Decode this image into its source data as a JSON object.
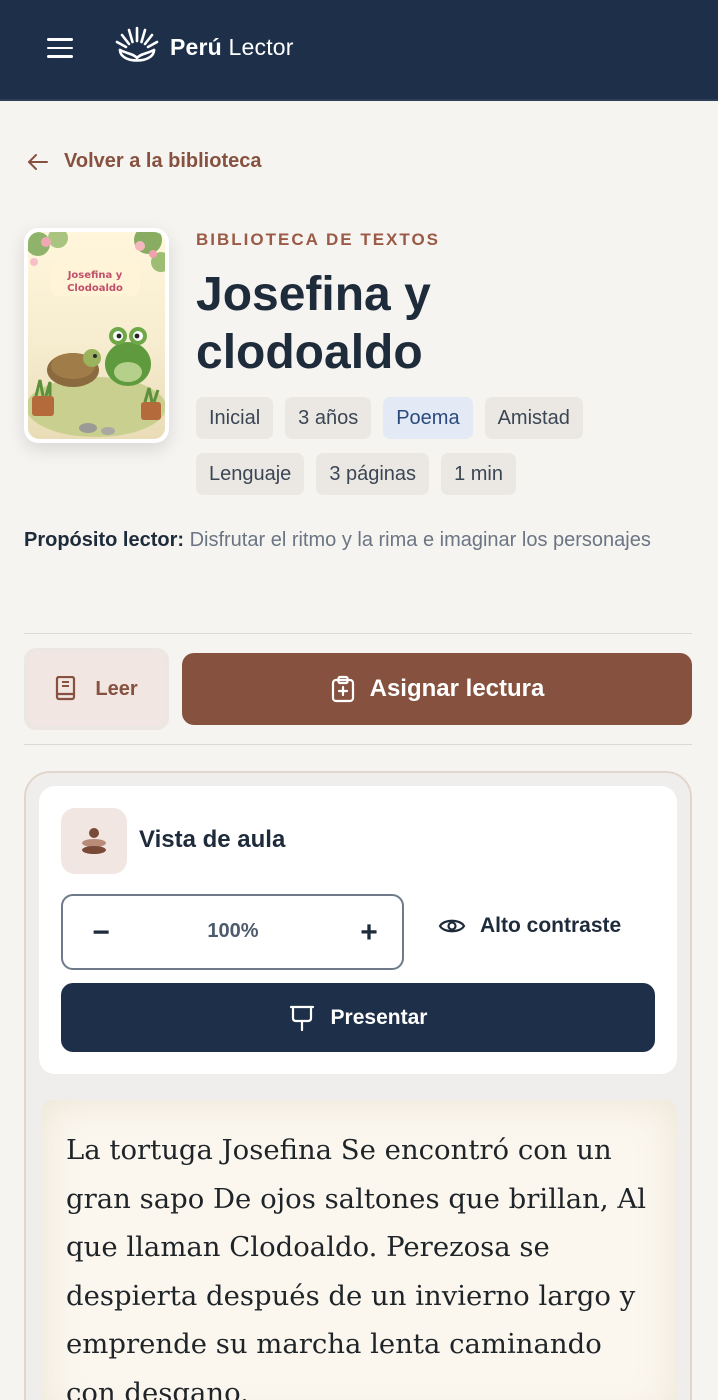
{
  "header": {
    "brand_bold": "Perú",
    "brand_light": "Lector"
  },
  "nav": {
    "back_label": "Volver a la biblioteca"
  },
  "book": {
    "cover_title_line1": "Josefina y",
    "cover_title_line2": "Clodoaldo",
    "eyebrow": "BIBLIOTECA DE TEXTOS",
    "title_line1": "Josefina y",
    "title_line2": "clodoaldo",
    "tags": [
      "Inicial",
      "3 años",
      "Poema",
      "Amistad",
      "Lenguaje",
      "3 páginas",
      "1 min"
    ],
    "purpose_label": "Propósito lector:",
    "purpose_text": "Disfrutar el ritmo y la rima e imaginar los personajes"
  },
  "actions": {
    "read_label": "Leer",
    "assign_label": "Asignar lectura"
  },
  "classroom": {
    "title": "Vista de aula",
    "zoom_minus": "−",
    "zoom_value": "100%",
    "zoom_plus": "+",
    "contrast_label": "Alto contraste",
    "present_label": "Presentar"
  },
  "reading": {
    "text": "La tortuga Josefina Se encontró con un gran sapo De ojos saltones que brillan, Al que llaman Clodoaldo. Perezosa se despierta después de un invierno largo y emprende su marcha lenta caminando con desgano."
  },
  "colors": {
    "header_bg": "#1e3049",
    "accent_brown": "#86523f",
    "page_bg": "#f6f4f1"
  }
}
